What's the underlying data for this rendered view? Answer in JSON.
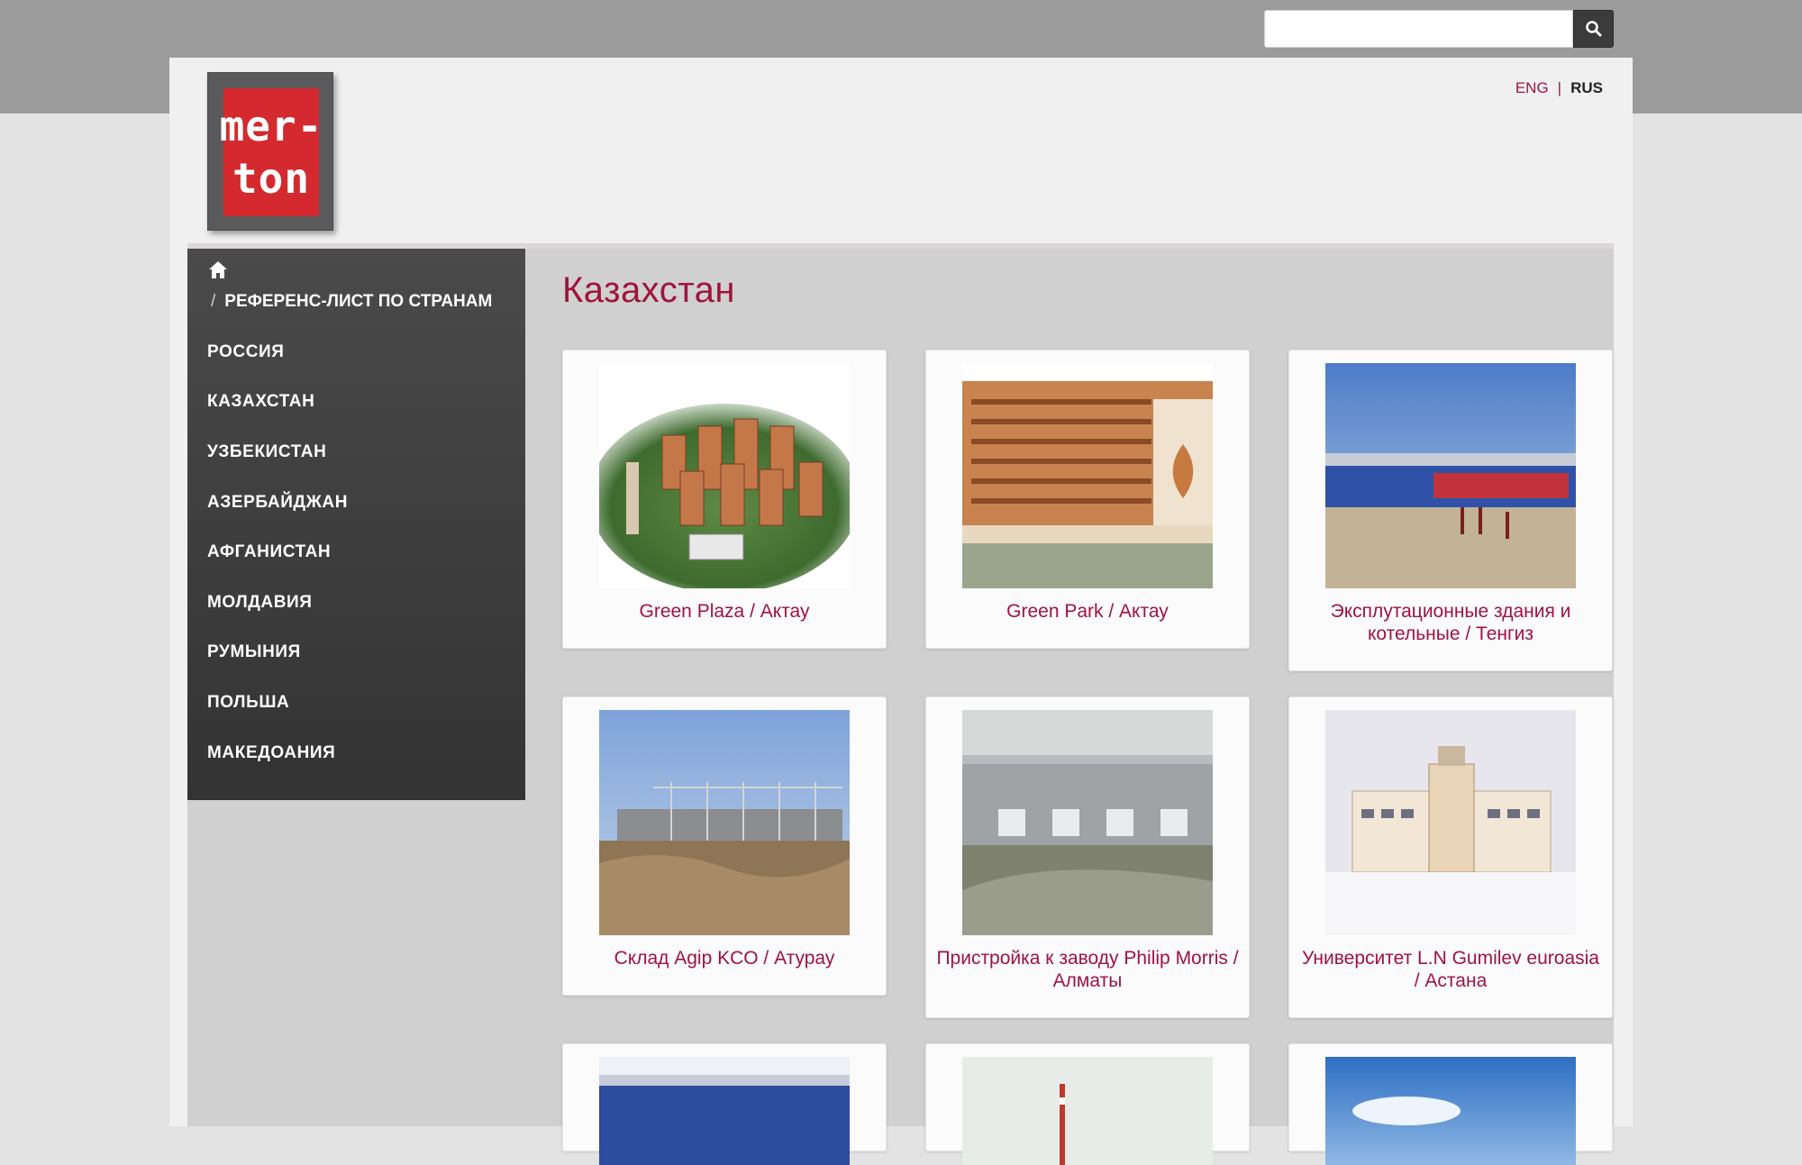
{
  "search": {
    "placeholder": "",
    "value": ""
  },
  "icons": {
    "search": "search-icon",
    "home": "home-icon"
  },
  "brand": {
    "logo_line1": "mer-",
    "logo_line2": "ton",
    "accent_color": "#a0133f",
    "logo_red": "#d42a2f"
  },
  "lang": {
    "eng": "ENG",
    "separator": "|",
    "rus": "RUS",
    "active": "RUS"
  },
  "breadcrumb": {
    "separator": "/",
    "current": "РЕФЕРЕНС-ЛИСТ ПО СТРАНАМ"
  },
  "sidebar": {
    "items": [
      {
        "label": "РОССИЯ"
      },
      {
        "label": "КАЗАХСТАН"
      },
      {
        "label": "УЗБЕКИСТАН"
      },
      {
        "label": "АЗЕРБАЙДЖАН"
      },
      {
        "label": "АФГАНИСТАН"
      },
      {
        "label": "МОЛДАВИЯ"
      },
      {
        "label": "РУМЫНИЯ"
      },
      {
        "label": "ПОЛЬША"
      },
      {
        "label": "МАКЕДОАНИЯ"
      }
    ]
  },
  "main": {
    "title": "Казахстан",
    "projects": [
      {
        "caption": "Green Plaza / Актау"
      },
      {
        "caption": "Green Park / Актау"
      },
      {
        "caption": "Эксплутационные здания и котельные / Тенгиз"
      },
      {
        "caption": "Склад Agip KCO / Атурау"
      },
      {
        "caption": "Пристройка к заводу Philip Morris / Алматы"
      },
      {
        "caption": "Университет L.N Gumilev euroasia / Астана"
      },
      {
        "caption": ""
      },
      {
        "caption": ""
      },
      {
        "caption": ""
      }
    ]
  }
}
